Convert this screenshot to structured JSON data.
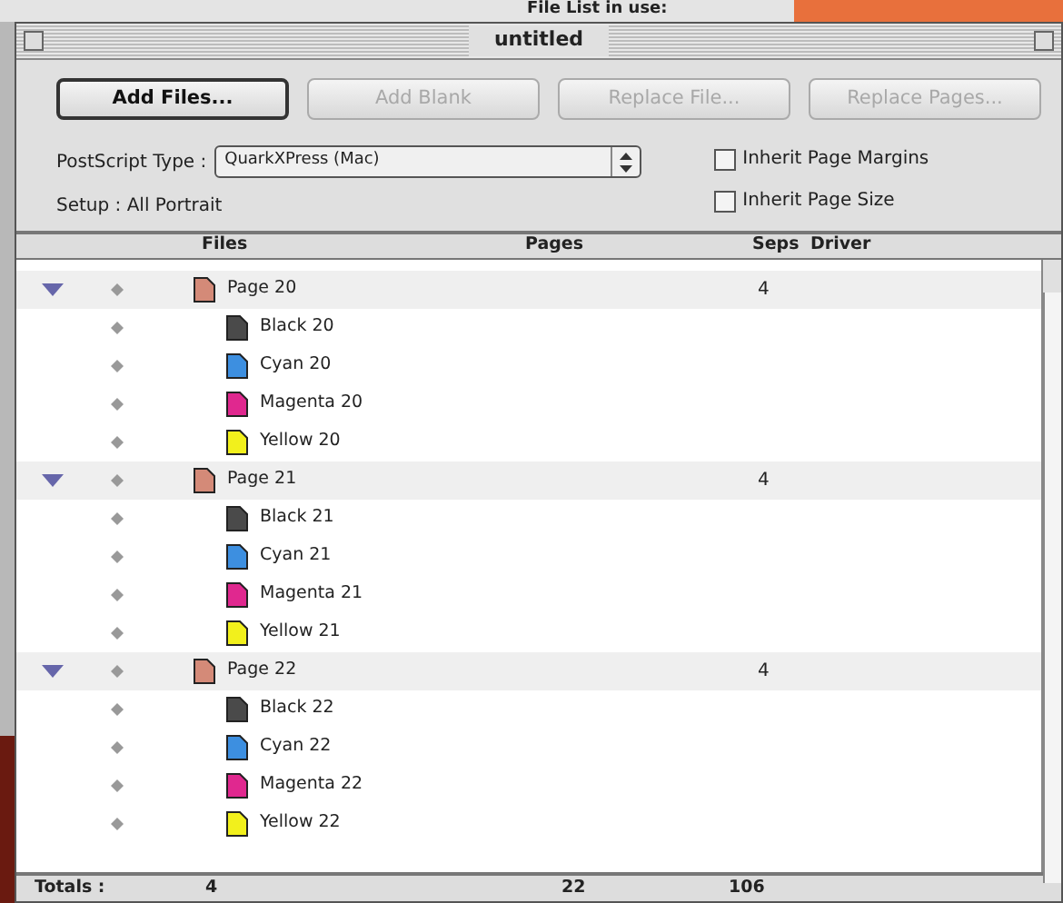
{
  "background": {
    "label": "File List in use:"
  },
  "window": {
    "title": "untitled"
  },
  "buttons": [
    {
      "label": "Add Files...",
      "disabled": false
    },
    {
      "label": "Add Blank",
      "disabled": true
    },
    {
      "label": "Replace File...",
      "disabled": true
    },
    {
      "label": "Replace Pages...",
      "disabled": true
    }
  ],
  "postscript_type": {
    "label": "PostScript Type :",
    "value": "QuarkXPress (Mac)"
  },
  "setup": "Setup : All Portrait",
  "options": [
    {
      "label": "Inherit Page Margins",
      "checked": false
    },
    {
      "label": "Inherit Page Size",
      "checked": false
    }
  ],
  "table": {
    "columns": [
      "Files",
      "Pages",
      "Seps",
      "Driver"
    ],
    "rows": [
      {
        "name": "Page 20",
        "seps": "4",
        "expanded": true,
        "children": [
          {
            "name": "Black 20",
            "color": "#4a4a4a"
          },
          {
            "name": "Cyan 20",
            "color": "#3d8fe0"
          },
          {
            "name": "Magenta 20",
            "color": "#e0288f"
          },
          {
            "name": "Yellow 20",
            "color": "#f2f01c"
          }
        ]
      },
      {
        "name": "Page 21",
        "seps": "4",
        "expanded": true,
        "children": [
          {
            "name": "Black 21",
            "color": "#4a4a4a"
          },
          {
            "name": "Cyan 21",
            "color": "#3d8fe0"
          },
          {
            "name": "Magenta 21",
            "color": "#e0288f"
          },
          {
            "name": "Yellow 21",
            "color": "#f2f01c"
          }
        ]
      },
      {
        "name": "Page 22",
        "seps": "4",
        "expanded": true,
        "children": [
          {
            "name": "Black 22",
            "color": "#4a4a4a"
          },
          {
            "name": "Cyan 22",
            "color": "#3d8fe0"
          },
          {
            "name": "Magenta 22",
            "color": "#e0288f"
          },
          {
            "name": "Yellow 22",
            "color": "#f2f01c"
          }
        ]
      }
    ]
  },
  "totals": {
    "label": "Totals :",
    "files": "4",
    "pages": "22",
    "seps": "106"
  }
}
